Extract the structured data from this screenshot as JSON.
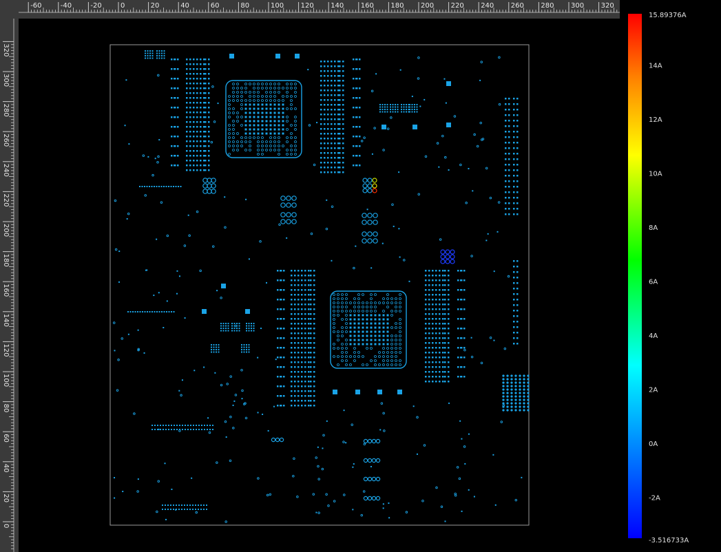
{
  "rulers": {
    "top": {
      "labels": [
        "-60",
        "-40",
        "-20",
        "0",
        "20",
        "40",
        "60",
        "80",
        "100",
        "120",
        "140",
        "160",
        "180",
        "200",
        "220",
        "240",
        "260",
        "280",
        "300",
        "320"
      ]
    },
    "left": {
      "labels": [
        "320",
        "300",
        "280",
        "260",
        "240",
        "220",
        "200",
        "180",
        "160",
        "140",
        "120",
        "100",
        "80",
        "60",
        "40",
        "20",
        "0"
      ]
    },
    "bg": "#3a3a3a",
    "tick": "#cfcfcf"
  },
  "board": {
    "outline": "#9a9a9a",
    "trace": "#1aa3e6"
  },
  "legend": {
    "max_label": "15.89376A",
    "min_label": "-3.516733A",
    "ticks": [
      "14A",
      "12A",
      "10A",
      "8A",
      "6A",
      "4A",
      "2A",
      "0A",
      "-2A"
    ],
    "min": -3.516733,
    "max": 15.89376,
    "tick_values": [
      14,
      12,
      10,
      8,
      6,
      4,
      2,
      0,
      -2
    ],
    "colors": [
      "#ff0000",
      "#ff8000",
      "#ffff00",
      "#00ff00",
      "#00ffff",
      "#0000ff"
    ]
  }
}
